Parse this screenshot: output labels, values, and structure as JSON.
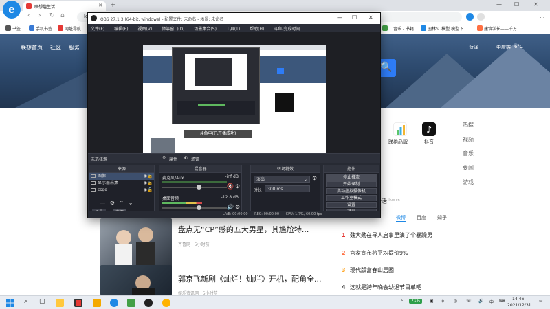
{
  "browser": {
    "tab_title": "联想趣生活",
    "address_hint": "lc",
    "right_extra": "...",
    "bookmarks": [
      {
        "label": "书签",
        "color": "#555555"
      },
      {
        "label": "手机书签",
        "color": "#3a7bd5"
      },
      {
        "label": "网址导航",
        "color": "#e53935"
      },
      {
        "label": "…音乐 - 书籍…",
        "color": "#43a047"
      },
      {
        "label": "园林SU模型 模型下…",
        "color": "#1e88e5"
      },
      {
        "label": "建筑学长——千万…",
        "color": "#ff7043"
      }
    ]
  },
  "page": {
    "nav": [
      "联想首页",
      "社区",
      "服务"
    ],
    "weather": {
      "city": "菏泽",
      "condition": "中度霾",
      "temp": "6°C"
    },
    "search_icon": "🔍",
    "apps": [
      {
        "label": "联络品牌",
        "icon": "bar-chart-icon",
        "color": "#5cc66a"
      },
      {
        "label": "抖音",
        "icon": "tiktok-icon",
        "color": "#111111"
      }
    ],
    "side_links": [
      "热搜",
      "视频",
      "音乐",
      "要闻",
      "游戏"
    ],
    "hot_header": "话",
    "hot_header_domain": "ilive.cn",
    "hot_tabs": [
      "微博",
      "百度",
      "知乎"
    ],
    "hot_list": [
      {
        "rank": "1",
        "text": "魏大勋在寻人启事里演了个暴躁男",
        "color": "#e53935"
      },
      {
        "rank": "2",
        "text": "官家宣布将平均提价9%",
        "color": "#ff7043"
      },
      {
        "rank": "3",
        "text": "现代版富春山居图",
        "color": "#ffa726"
      },
      {
        "rank": "4",
        "text": "这就是跨年晚会幼退节目单吧",
        "color": "#333333"
      }
    ],
    "news": [
      {
        "title": "盘点无“CP”感的五大男星，其尴尬特...",
        "source": "齐鲁网 · 5小时前"
      },
      {
        "title": "郭京飞新剧《灿烂！灿烂》开机，配角全...",
        "source": "娱乐资讯网 · 5小时前"
      }
    ]
  },
  "obs": {
    "title": "OBS 27.1.3 (64-bit, windows) - 配置文件: 未命名 - 场景: 未命名",
    "menu": [
      "文件(F)",
      "编辑(E)",
      "视图(V)",
      "停靠窗口(D)",
      "场景集合(S)",
      "工具(T)",
      "帮助(H)",
      "斗鱼-完成时间"
    ],
    "preview_overlay": "斗鱼中(已开播成功)",
    "no_source_selected": "未选择源",
    "props_button": "属性",
    "filters_button": "滤镜",
    "sources_header": "来源",
    "sources": [
      {
        "name": "图像",
        "selected": true
      },
      {
        "name": "显示器采集",
        "selected": false
      },
      {
        "name": "csgo",
        "selected": false
      }
    ],
    "sources_tabs": [
      "场景",
      "来源"
    ],
    "mixer_header": "混音器",
    "mixer": [
      {
        "name": "麦克风/Aux",
        "db": "-inf dB",
        "level": 0.0
      },
      {
        "name": "桌面音频",
        "db": "-12.8 dB",
        "level": 0.62
      }
    ],
    "transitions_header": "转场特效",
    "transition_name": "淡出",
    "duration_label": "时长",
    "duration_value": "300 ms",
    "controls_header": "控件",
    "controls": [
      "停止推流",
      "开始录制",
      "启动虚拟摄像机",
      "工作室模式",
      "设置",
      "退出"
    ],
    "status": {
      "live": "LIVE: 00:00:00",
      "rec": "REC: 00:00:00",
      "cpu": "CPU: 1.7%, 60.00 fps"
    }
  },
  "taskbar": {
    "time": "14:46",
    "date": "2021/12/31",
    "battery": "71%",
    "lang": "中"
  }
}
